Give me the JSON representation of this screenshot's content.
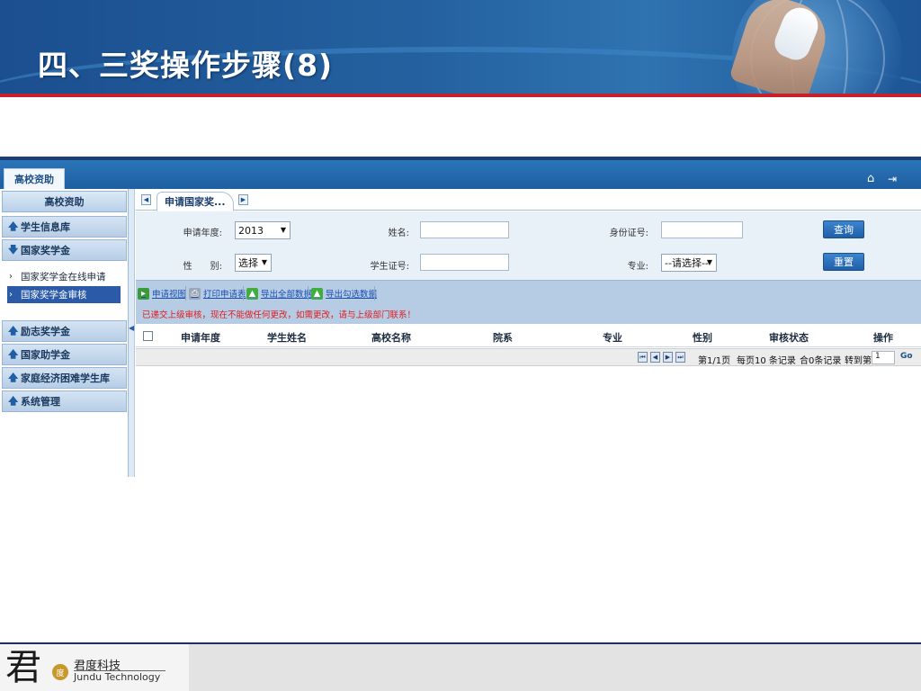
{
  "slide": {
    "title": "四、三奖操作步骤(8)"
  },
  "app": {
    "tab_label": "高校资助",
    "home_icon": "home-icon",
    "exit_icon": "exit-icon"
  },
  "sidebar": {
    "header": "高校资助",
    "categories": [
      {
        "label": "学生信息库",
        "icon": "arrow-up-icon"
      },
      {
        "label": "国家奖学金",
        "icon": "arrow-down-icon"
      },
      {
        "label": "励志奖学金",
        "icon": "arrow-up-icon"
      },
      {
        "label": "国家助学金",
        "icon": "arrow-up-icon"
      },
      {
        "label": "家庭经济困难学生库",
        "icon": "arrow-up-icon"
      },
      {
        "label": "系统管理",
        "icon": "arrow-up-icon"
      }
    ],
    "subitems": [
      {
        "label": "国家奖学金在线申请",
        "active": false
      },
      {
        "label": "国家奖学金审核",
        "active": true
      }
    ]
  },
  "main": {
    "tab_label": "申请国家奖...",
    "form": {
      "year_label": "申请年度:",
      "year_value": "2013",
      "name_label": "姓名:",
      "name_value": "",
      "id_label": "身份证号:",
      "id_value": "",
      "gender_label": "性　　别:",
      "gender_value": "选择",
      "student_id_label": "学生证号:",
      "student_id_value": "",
      "major_label": "专业:",
      "major_value": "--请选择--",
      "query_button": "查询",
      "reset_button": "重置"
    },
    "toolbar": {
      "items": [
        "申请视图",
        "打印申请表",
        "导出全部数据",
        "导出勾选数据"
      ],
      "notice": "已递交上级审核，现在不能做任何更改，如需更改，请与上级部门联系！"
    },
    "table": {
      "columns": [
        "申请年度",
        "学生姓名",
        "高校名称",
        "院系",
        "专业",
        "性别",
        "审核状态",
        "操作"
      ]
    },
    "pager": {
      "page_info": "第1/1页",
      "per_page": "每页10 条记录",
      "total": "合0条记录",
      "goto_label": "转到第",
      "goto_value": "1",
      "go": "Go"
    }
  },
  "footer": {
    "logo_glyph": "君",
    "logo_seal": "度",
    "company_cn": "君度科技",
    "company_en": "Jundu Technology"
  },
  "colors": {
    "banner": "#24609f",
    "accent_red": "#c8202a",
    "header_blue": "#1e5fa0",
    "notice_red": "#e21b1b"
  }
}
